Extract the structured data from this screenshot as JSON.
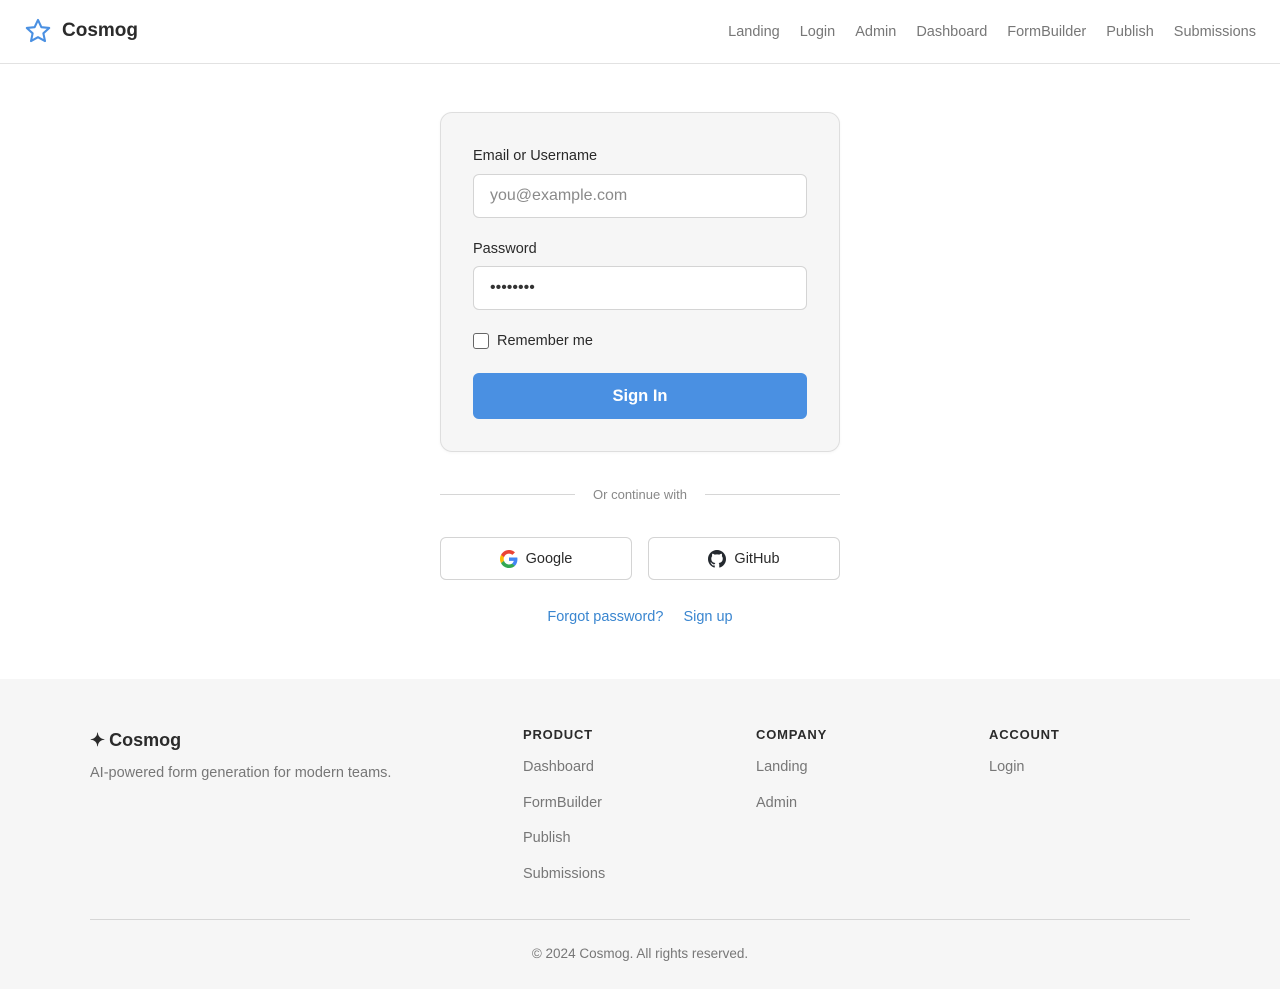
{
  "header": {
    "brand": "Cosmog",
    "nav": [
      "Landing",
      "Login",
      "Admin",
      "Dashboard",
      "FormBuilder",
      "Publish",
      "Submissions"
    ]
  },
  "login": {
    "email_label": "Email or Username",
    "email_placeholder": "you@example.com",
    "password_label": "Password",
    "password_value": "••••••••",
    "remember_label": "Remember me",
    "remember_checked": false,
    "submit_label": "Sign In"
  },
  "divider_text": "Or continue with",
  "social": {
    "google_label": "Google",
    "github_label": "GitHub"
  },
  "links": {
    "forgot": "Forgot password?",
    "signup": "Sign up"
  },
  "footer": {
    "brand_mark": "✦",
    "brand": "Cosmog",
    "tagline": "AI-powered form generation for modern teams.",
    "columns": [
      {
        "heading": "PRODUCT",
        "links": [
          "Dashboard",
          "FormBuilder",
          "Publish",
          "Submissions"
        ]
      },
      {
        "heading": "COMPANY",
        "links": [
          "Landing",
          "Admin"
        ]
      },
      {
        "heading": "ACCOUNT",
        "links": [
          "Login"
        ]
      }
    ],
    "copyright": "© 2024 Cosmog. All rights reserved."
  },
  "colors": {
    "accent": "#4a90e2",
    "link": "#3a86d0",
    "footer_bg": "#f6f6f6"
  },
  "icons": {
    "logo": "star-outline-icon",
    "google": "google-g-icon",
    "github": "github-octocat-icon"
  }
}
